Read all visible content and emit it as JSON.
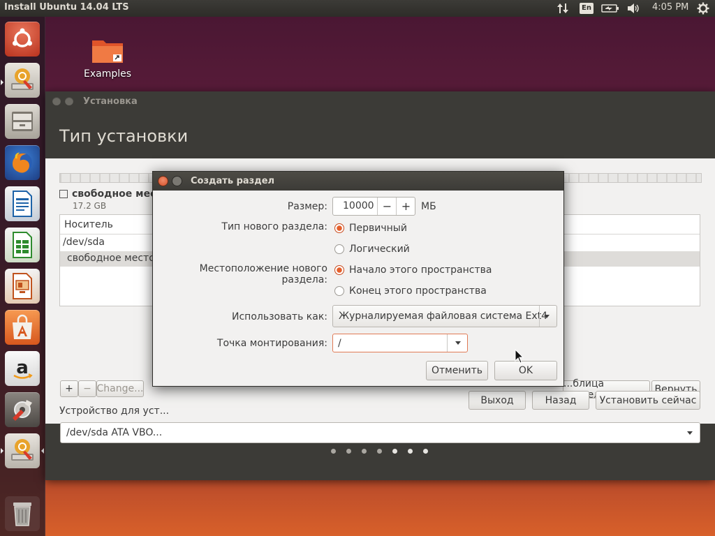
{
  "topbar": {
    "title": "Install Ubuntu 14.04 LTS",
    "language": "En",
    "time": "4:05 PM",
    "icons": [
      "network-transfer-icon",
      "keyboard-layout-icon",
      "battery-icon",
      "volume-icon",
      "settings-gear-icon"
    ]
  },
  "launcher": {
    "items": [
      "ubuntu-dash-icon",
      "installer-icon",
      "files-icon",
      "firefox-icon",
      "libreoffice-writer-icon",
      "libreoffice-calc-icon",
      "libreoffice-impress-icon",
      "ubuntu-software-center-icon",
      "amazon-icon",
      "system-settings-icon",
      "installer-active-icon",
      "trash-icon"
    ]
  },
  "desktop": {
    "icon_label": "Examples"
  },
  "installer": {
    "window_title": "Установка",
    "heading": "Тип установки",
    "free_space_label": "свободное место",
    "free_space_size": "17.2 GB",
    "table": {
      "column_device": "Носитель",
      "row_device": "/dev/sda",
      "row_free": "свободное место"
    },
    "buttons": {
      "add": "+",
      "remove": "−",
      "change": "Change...",
      "new_table": "...блица разделов...",
      "revert": "Вернуть",
      "quit": "Выход",
      "back": "Назад",
      "install_now": "Установить сейчас"
    },
    "bootloader_label": "Устройство для уст...",
    "bootloader_value": "/dev/sda  ATA VBO..."
  },
  "dialog": {
    "title": "Создать раздел",
    "size_label": "Размер:",
    "size_value": "10000",
    "size_minus": "−",
    "size_plus": "+",
    "size_unit": "МБ",
    "type_label": "Тип нового раздела:",
    "type_primary": "Первичный",
    "type_logical": "Логический",
    "type_selected": "primary",
    "location_label": "Местоположение нового раздела:",
    "location_start": "Начало этого пространства",
    "location_end": "Конец этого пространства",
    "location_selected": "start",
    "use_as_label": "Использовать как:",
    "use_as_value": "Журналируемая файловая система Ext4",
    "mount_label": "Точка монтирования:",
    "mount_value": "/",
    "cancel": "Отменить",
    "ok": "OK"
  },
  "progress_dots": 7,
  "colors": {
    "accent_orange": "#e55f2b",
    "panel_dark": "#3c3b37",
    "dialog_bg": "#f2f1f0"
  }
}
